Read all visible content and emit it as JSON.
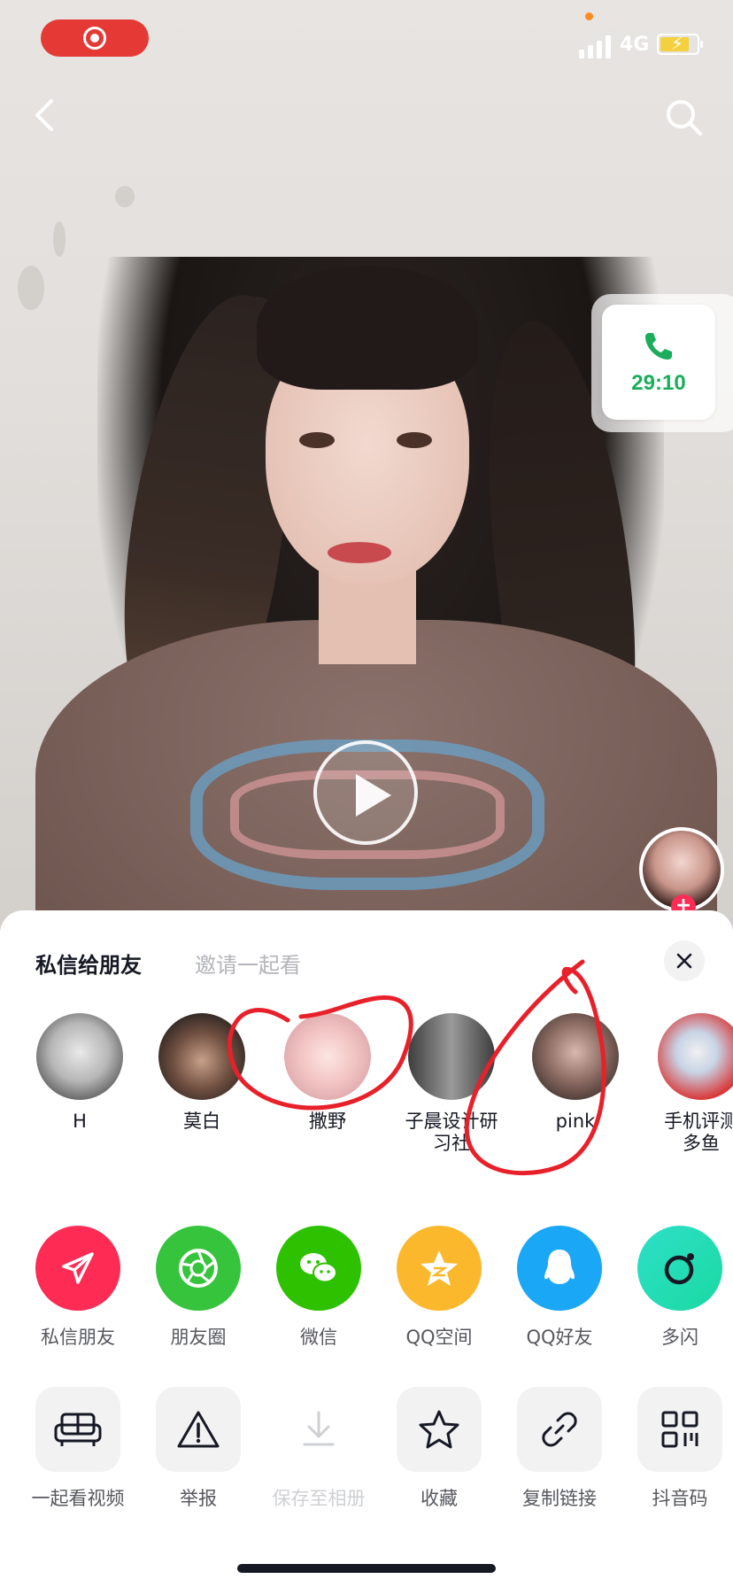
{
  "status_bar": {
    "network": "4G",
    "battery_level": 0.8,
    "colors": {
      "record": "#e53935",
      "battery": "#f4d03f"
    }
  },
  "call_widget": {
    "time": "29:10",
    "color": "#1aad5b"
  },
  "sheet": {
    "tabs": {
      "active": "私信给朋友",
      "inactive": "邀请一起看"
    },
    "close_icon": "close-icon",
    "friends": [
      {
        "name": "H",
        "avatar_color": "#8b8b8b"
      },
      {
        "name": "莫白",
        "avatar_color": "#3b3535"
      },
      {
        "name": "撒野",
        "avatar_color": "#f1c9c8"
      },
      {
        "name": "子晨设计研\n习社",
        "avatar_color": "#5a5a5a"
      },
      {
        "name": "pink",
        "avatar_color": "#6b5a55"
      },
      {
        "name": "手机评测\n多鱼",
        "avatar_color": "#d83a3a"
      }
    ],
    "share_targets": [
      {
        "label": "私信朋友",
        "icon": "paper-plane-icon",
        "color": "#fe2c55"
      },
      {
        "label": "朋友圈",
        "icon": "moments-shutter-icon",
        "color": "#35c43c"
      },
      {
        "label": "微信",
        "icon": "wechat-icon",
        "color": "#2dc100"
      },
      {
        "label": "QQ空间",
        "icon": "qzone-star-icon",
        "color": "#fbb82c"
      },
      {
        "label": "QQ好友",
        "icon": "qq-penguin-icon",
        "color": "#1aa7f5"
      },
      {
        "label": "多闪",
        "icon": "duoshan-icon",
        "color": "#2de0c8"
      }
    ],
    "actions": [
      {
        "label": "一起看视频",
        "icon": "sofa-icon",
        "enabled": true
      },
      {
        "label": "举报",
        "icon": "warning-icon",
        "enabled": true
      },
      {
        "label": "保存至相册",
        "icon": "download-icon",
        "enabled": false
      },
      {
        "label": "收藏",
        "icon": "star-icon",
        "enabled": true
      },
      {
        "label": "复制链接",
        "icon": "link-icon",
        "enabled": true
      },
      {
        "label": "抖音码",
        "icon": "qr-code-icon",
        "enabled": true
      }
    ]
  }
}
